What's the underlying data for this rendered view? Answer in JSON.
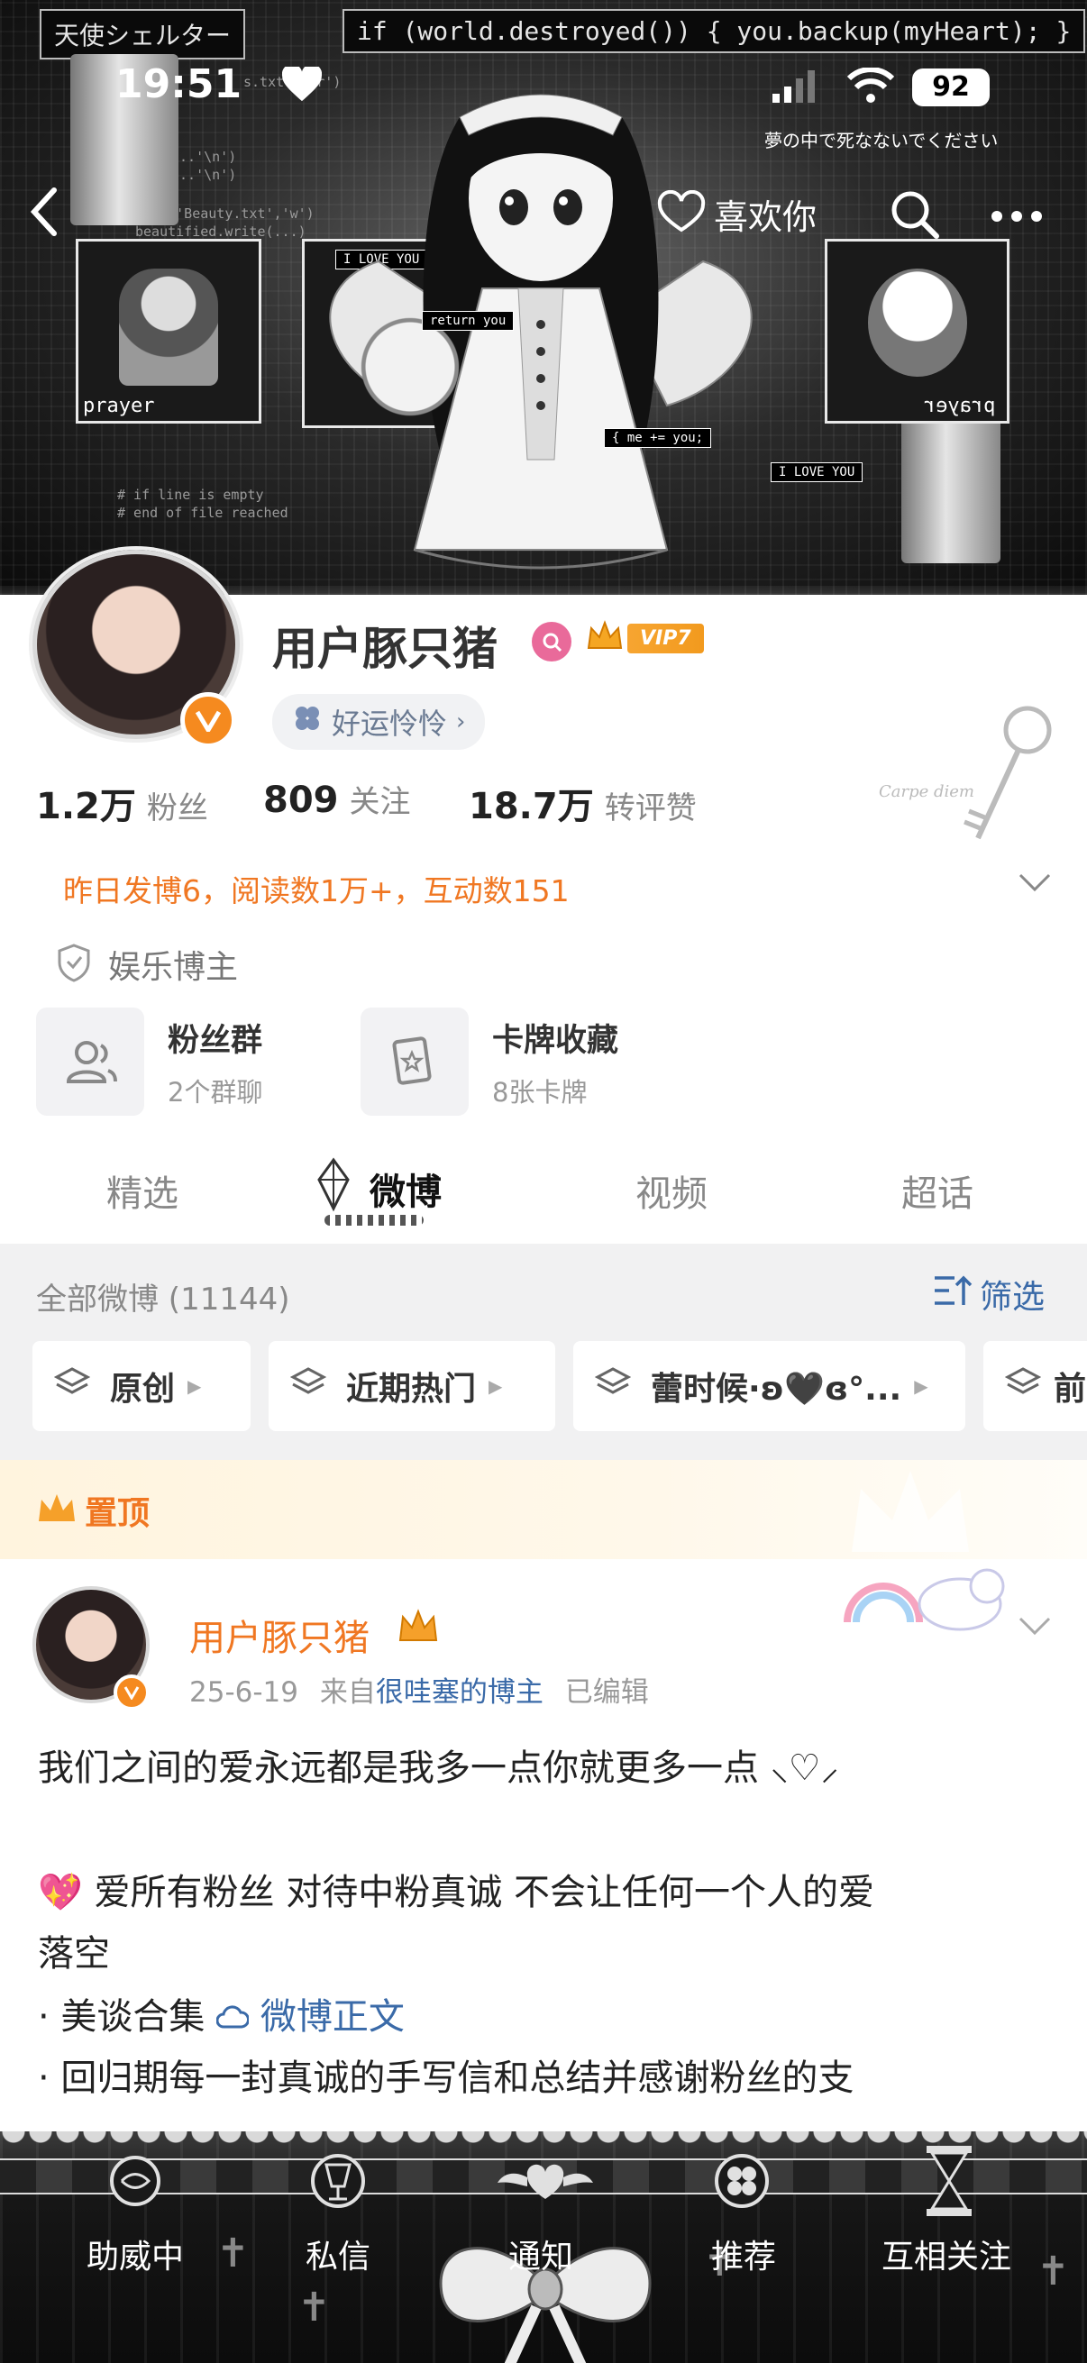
{
  "status_bar": {
    "time": "19:51",
    "battery": "92"
  },
  "banner": {
    "title_left": "天使シェルター",
    "title_right": "if (world.destroyed()) { you.backup(myHeart); }",
    "jp_caption": "夢の中で死なないでください",
    "code_lines": [
      "s.txt', 'r')",
      "...'\\n')",
      "...'\\n')",
      "open('Beauty.txt','w')",
      "beautified.write(...)",
      "# if line is empty",
      "# end of file reached"
    ],
    "frame_left_label": "prayer",
    "frame_right_label": "prayer",
    "love_label_1": "I LOVE YOU",
    "love_label_2": "I LOVE YOU",
    "code_bubble_1": "return you",
    "code_bubble_2": "{ me += you;",
    "like_label": "喜欢你"
  },
  "profile": {
    "username": "用户豚只猪",
    "vip_label": "VIP7",
    "lucky_pill": "好运怜怜",
    "stats": [
      {
        "num": "1.2万",
        "label": "粉丝"
      },
      {
        "num": "809",
        "label": "关注"
      },
      {
        "num": "18.7万",
        "label": "转评赞"
      }
    ],
    "yesterday": "昨日发博6，阅读数1万+，互动数151",
    "category": "娱乐博主",
    "cards": [
      {
        "title": "粉丝群",
        "sub": "2个群聊"
      },
      {
        "title": "卡牌收藏",
        "sub": "8张卡牌"
      }
    ],
    "watermark": "Carpe diem"
  },
  "tabs": [
    "精选",
    "微博",
    "视频",
    "超话"
  ],
  "filter_bar": {
    "all_label": "全部微博 (11144)",
    "filter_label": "筛选"
  },
  "chips": [
    "原创",
    "近期热门",
    "蕾时候·ʚ🖤ɞ°...",
    "前"
  ],
  "pinned": {
    "label": "置顶"
  },
  "post": {
    "name": "用户豚只猪",
    "date": "25-6-19",
    "from_prefix": "来自",
    "source": "很哇塞的博主",
    "edited": "已编辑",
    "line1": "我们之间的爱永远都是我多一点你就更多一点 ⸜♡⸝",
    "line2_emoji": "💖",
    "line2": "爱所有粉丝 对待中粉真诚 不会让任何一个人的爱",
    "line3": "落空",
    "line4_prefix": "· 美谈合集 ",
    "line4_link": "微博正文",
    "line5": "· 回归期每一封真诚的手写信和总结并感谢粉丝的支"
  },
  "bottom_tabs": [
    "助威中",
    "私信",
    "通知",
    "推荐",
    "互相关注"
  ]
}
